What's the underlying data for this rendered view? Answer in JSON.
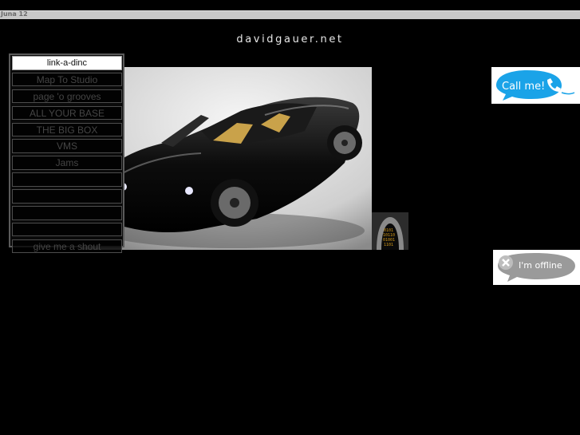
{
  "topbar": {
    "label": "Juna 12"
  },
  "site": {
    "title": "davidgauer.net"
  },
  "nav": {
    "items": [
      {
        "label": "link-a-dinc"
      },
      {
        "label": "Map To Studio"
      },
      {
        "label": "page 'o grooves"
      },
      {
        "label": "ALL YOUR BASE"
      },
      {
        "label": "THE BIG BOX"
      },
      {
        "label": "VMS"
      },
      {
        "label": "Jams"
      },
      {
        "label": ""
      },
      {
        "label": ""
      },
      {
        "label": ""
      },
      {
        "label": ""
      },
      {
        "label": "give me a shout"
      }
    ]
  },
  "badges": {
    "call": "Call me!",
    "offline": "I'm offline"
  },
  "colors": {
    "background": "#000000",
    "topbar": "#c8c8c8",
    "call_bubble": "#1aa3e8"
  }
}
